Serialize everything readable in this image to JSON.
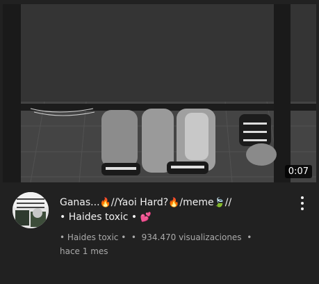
{
  "video": {
    "duration": "0:07"
  },
  "channel": {
    "avatar_icon": "channel-avatar-image"
  },
  "title": {
    "part1": "Ganas...",
    "fire_icon_1": "🔥",
    "part2": "//Yaoi Hard?",
    "fire_icon_2": "🔥",
    "part3": "/meme",
    "leaf_icon": "🍃",
    "part4": "//",
    "line2_prefix": "• Haides toxic •",
    "hearts_icon": "💕"
  },
  "meta": {
    "channel_name": "• Haides toxic •",
    "separator": "•",
    "views": "934.470 visualizaciones",
    "separator2": "•",
    "age": "hace 1 mes"
  },
  "menu": {
    "icon": "more-vertical-icon"
  },
  "colors": {
    "background": "#212121",
    "title_text": "#f1f1f1",
    "meta_text": "#aaaaaa"
  }
}
